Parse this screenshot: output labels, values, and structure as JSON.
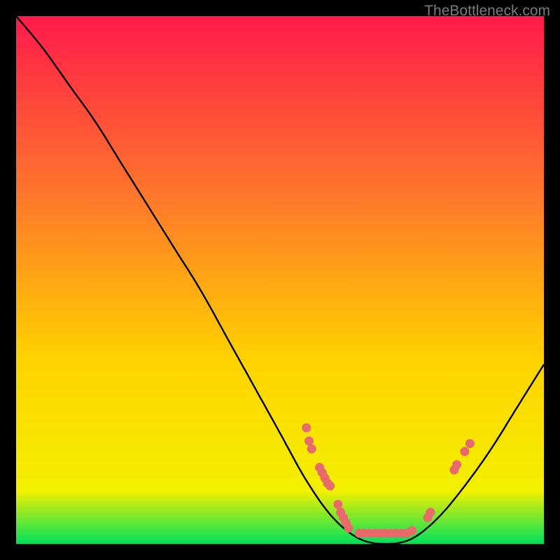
{
  "watermark": "TheBottleneck.com",
  "chart_data": {
    "type": "line",
    "title": "",
    "xlabel": "",
    "ylabel": "",
    "xlim": [
      0,
      100
    ],
    "ylim": [
      0,
      100
    ],
    "background_gradient": {
      "top": "#ff1a4b",
      "mid": "#ffd200",
      "bottom": "#00e05c"
    },
    "curve": [
      {
        "x": 0,
        "y": 100
      },
      {
        "x": 5,
        "y": 94
      },
      {
        "x": 10,
        "y": 87
      },
      {
        "x": 15,
        "y": 80
      },
      {
        "x": 20,
        "y": 72
      },
      {
        "x": 25,
        "y": 64
      },
      {
        "x": 30,
        "y": 56
      },
      {
        "x": 35,
        "y": 48
      },
      {
        "x": 40,
        "y": 39
      },
      {
        "x": 45,
        "y": 30
      },
      {
        "x": 50,
        "y": 21
      },
      {
        "x": 55,
        "y": 12
      },
      {
        "x": 60,
        "y": 5
      },
      {
        "x": 65,
        "y": 1
      },
      {
        "x": 70,
        "y": 0
      },
      {
        "x": 75,
        "y": 1
      },
      {
        "x": 80,
        "y": 5
      },
      {
        "x": 85,
        "y": 11
      },
      {
        "x": 90,
        "y": 18
      },
      {
        "x": 95,
        "y": 26
      },
      {
        "x": 100,
        "y": 34
      }
    ],
    "markers": [
      {
        "x": 55.0,
        "y": 22.0
      },
      {
        "x": 55.5,
        "y": 19.5
      },
      {
        "x": 56.0,
        "y": 18.0
      },
      {
        "x": 57.5,
        "y": 14.5
      },
      {
        "x": 58.0,
        "y": 13.5
      },
      {
        "x": 58.5,
        "y": 12.5
      },
      {
        "x": 59.0,
        "y": 11.5
      },
      {
        "x": 59.5,
        "y": 11.0
      },
      {
        "x": 61.0,
        "y": 7.5
      },
      {
        "x": 61.5,
        "y": 6.0
      },
      {
        "x": 62.0,
        "y": 5.0
      },
      {
        "x": 62.5,
        "y": 4.0
      },
      {
        "x": 63.0,
        "y": 3.0
      },
      {
        "x": 65.0,
        "y": 2.0
      },
      {
        "x": 66.0,
        "y": 2.0
      },
      {
        "x": 67.0,
        "y": 2.0
      },
      {
        "x": 68.0,
        "y": 2.0
      },
      {
        "x": 69.0,
        "y": 2.0
      },
      {
        "x": 70.0,
        "y": 2.0
      },
      {
        "x": 71.0,
        "y": 2.0
      },
      {
        "x": 72.0,
        "y": 2.0
      },
      {
        "x": 73.0,
        "y": 2.0
      },
      {
        "x": 74.0,
        "y": 2.0
      },
      {
        "x": 75.0,
        "y": 2.5
      },
      {
        "x": 78.0,
        "y": 5.0
      },
      {
        "x": 78.5,
        "y": 6.0
      },
      {
        "x": 83.0,
        "y": 14.0
      },
      {
        "x": 83.5,
        "y": 15.0
      },
      {
        "x": 85.0,
        "y": 17.5
      },
      {
        "x": 86.0,
        "y": 19.0
      }
    ],
    "marker_color": "#e86a6a",
    "curve_color": "#000000"
  }
}
